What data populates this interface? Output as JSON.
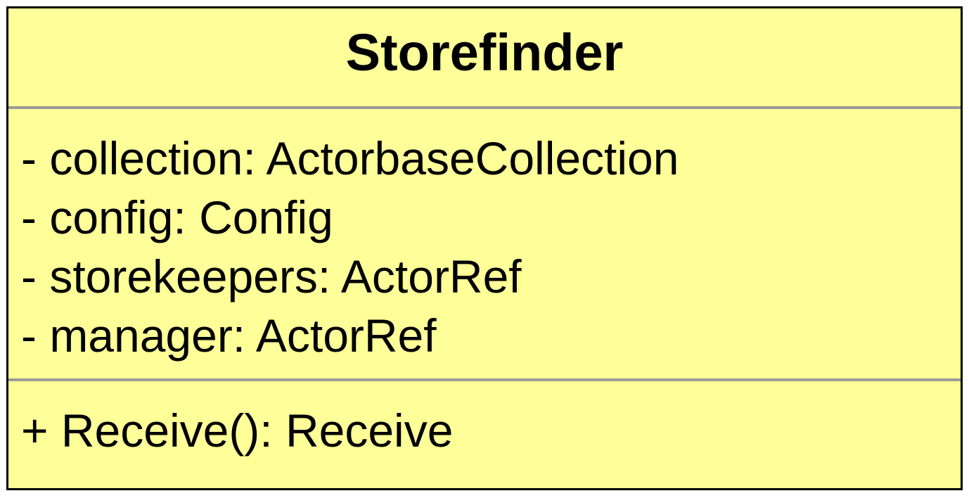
{
  "class": {
    "name": "Storefinder",
    "attributes": [
      "- collection: ActorbaseCollection",
      "- config: Config",
      "- storekeepers: ActorRef",
      "- manager: ActorRef"
    ],
    "operations": [
      "+ Receive(): Receive"
    ]
  },
  "colors": {
    "fill": "#ffff99",
    "border": "#000000",
    "divider": "#9a9a9a"
  }
}
